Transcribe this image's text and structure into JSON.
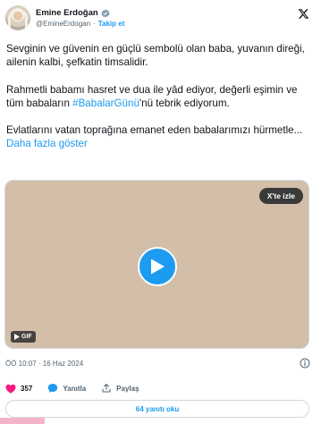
{
  "author": {
    "name": "Emine Erdoğan",
    "handle": "@EmineErdogan",
    "separator": "·",
    "follow_label": "Takip et"
  },
  "tweet": {
    "paragraph1": "Sevginin ve güvenin en güçlü sembolü olan baba, yuvanın direği, ailenin kalbi, şefkatin timsalidir.",
    "paragraph2_before": "Rahmetli babamı hasret ve dua ile yâd ediyor, değerli eşimin ve tüm babaların ",
    "hashtag": "#BabalarGünü",
    "paragraph2_after": "'nü tebrik ediyorum.",
    "paragraph3": "Evlatlarını vatan toprağına emanet eden babalarımızı hürmetle... ",
    "show_more": "Daha fazla göster"
  },
  "media": {
    "watch_label": "X'te izle",
    "gif_label": "GIF",
    "background_color": "#d3bea9"
  },
  "meta": {
    "timestamp": "ÖÖ 10:07 · 16 Haz 2024"
  },
  "actions": {
    "like_count": "357",
    "reply_label": "Yanıtla",
    "share_label": "Paylaş"
  },
  "replies_button": "64 yanıtı oku",
  "colors": {
    "accent": "#1d9bf0",
    "like": "#f91880",
    "text": "#0f1419",
    "muted": "#536471"
  }
}
